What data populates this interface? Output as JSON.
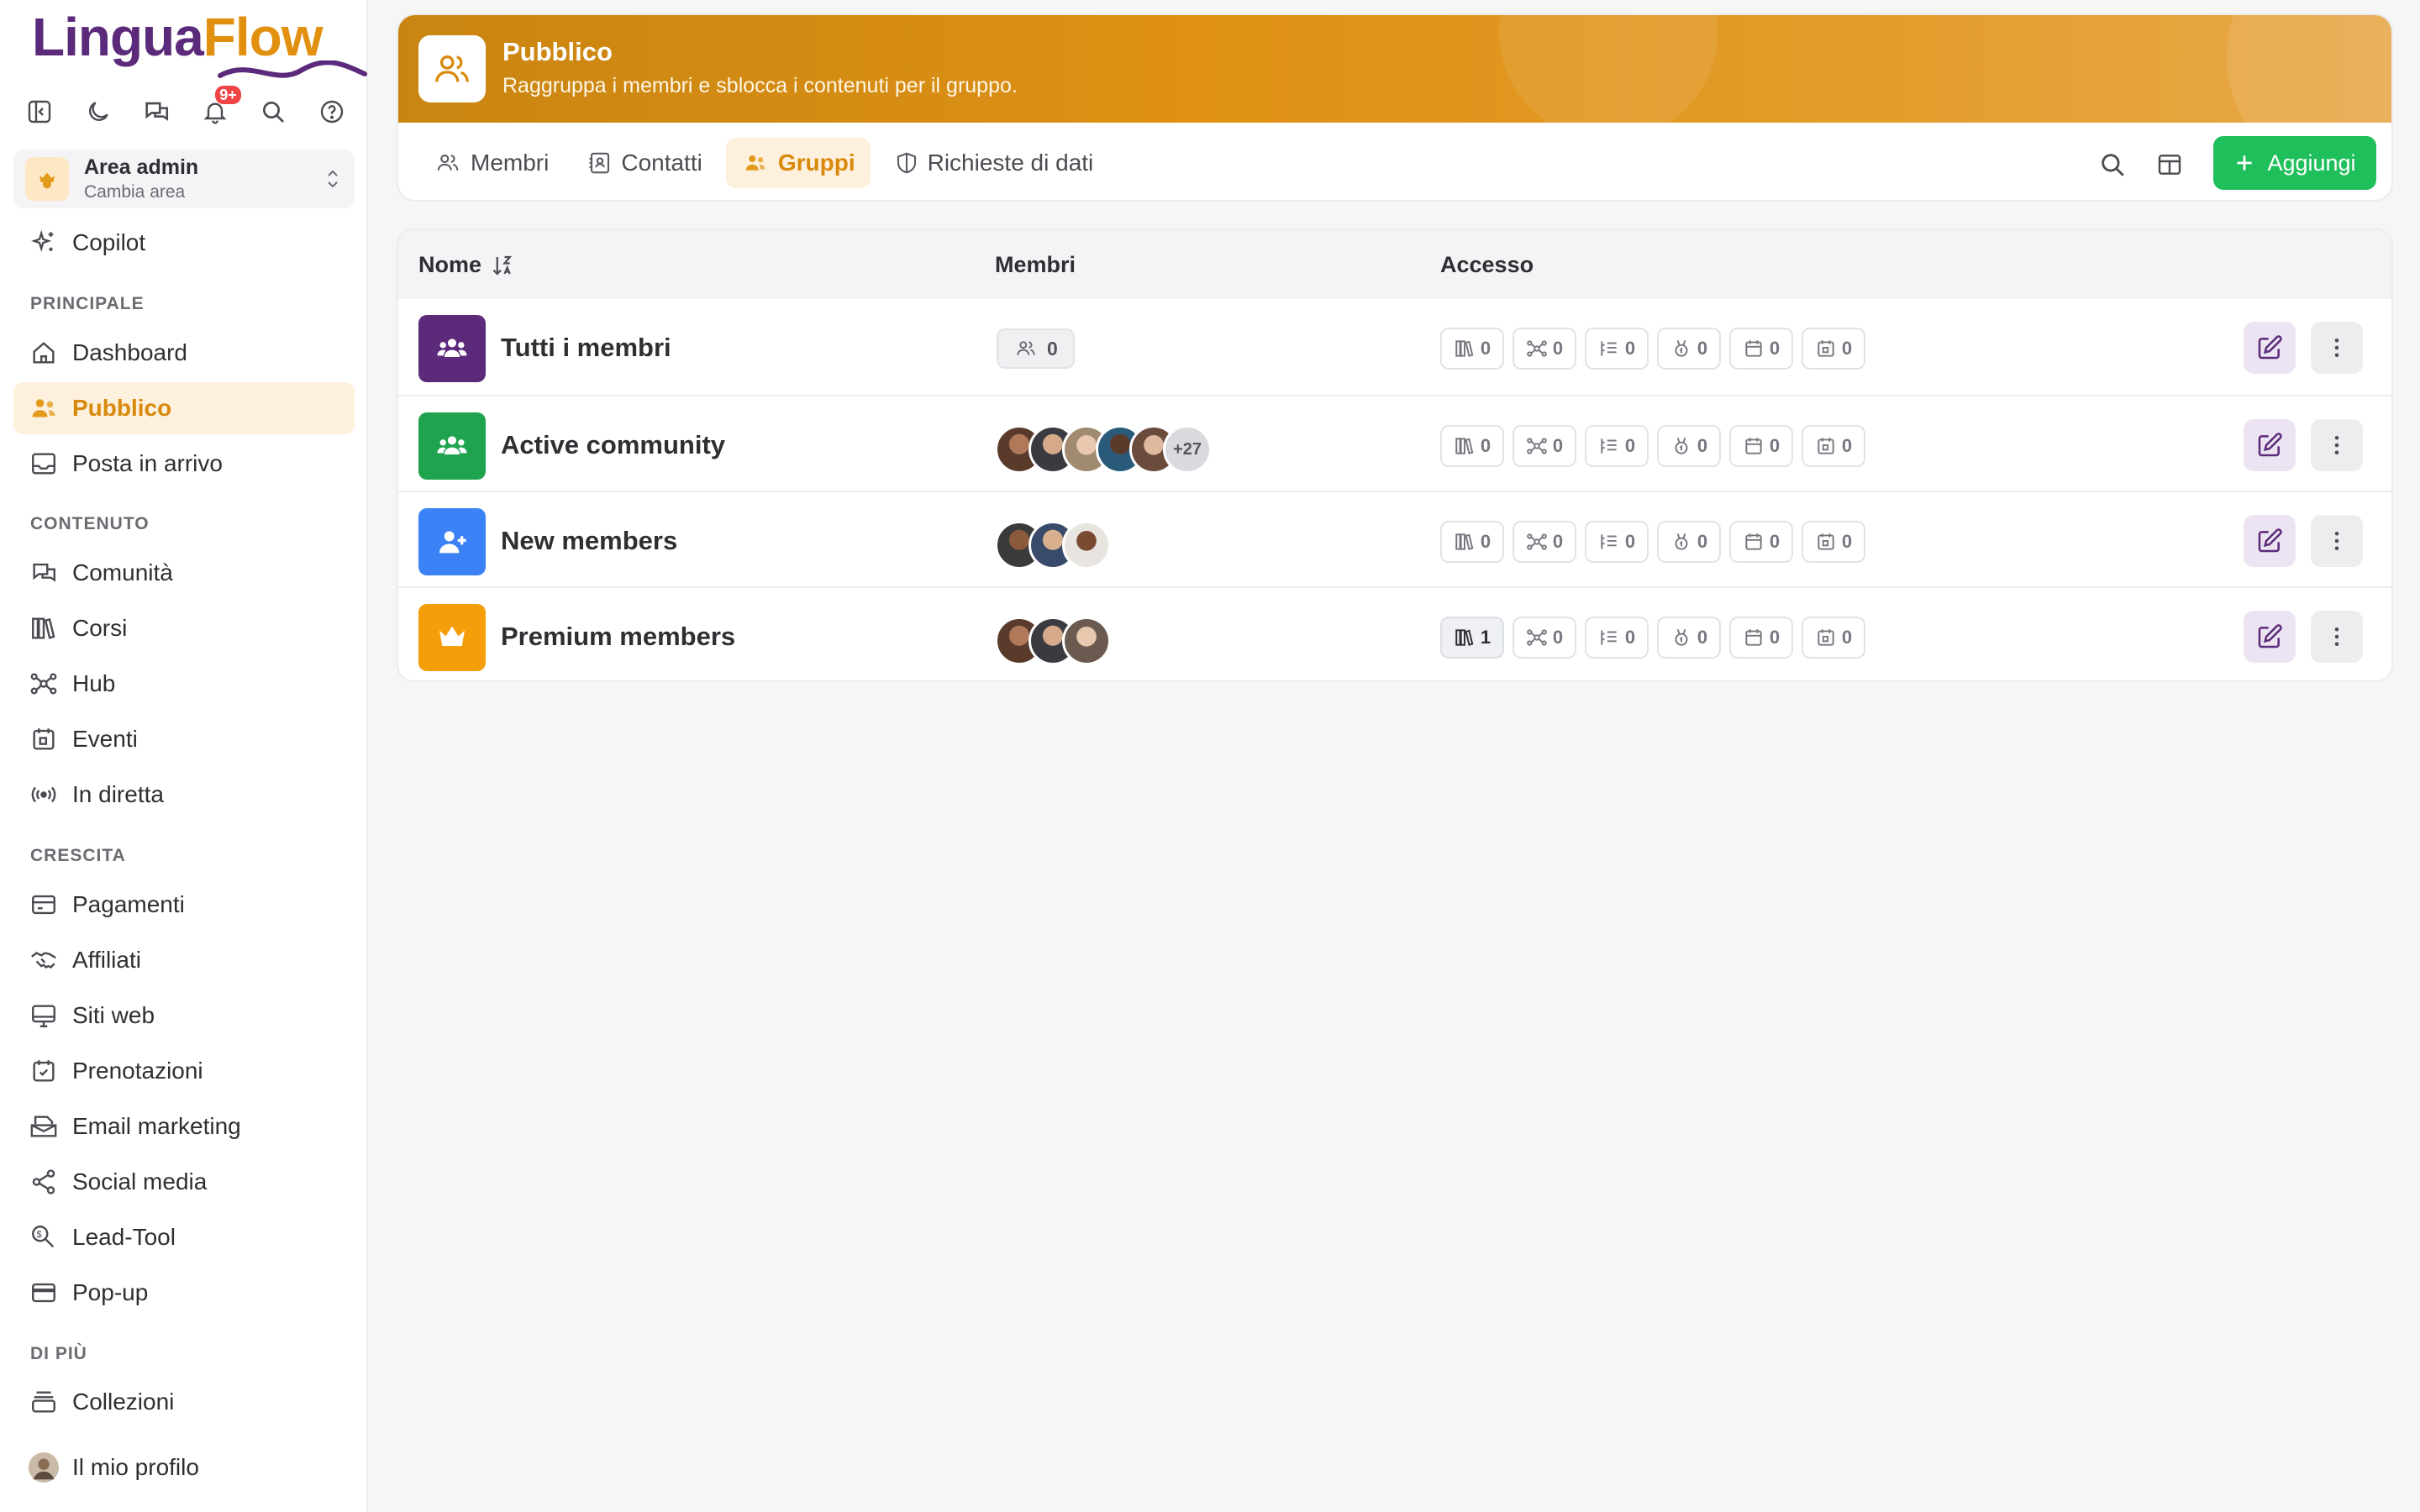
{
  "app": {
    "logo_part1": "Lingua",
    "logo_part2": "Flow",
    "notification_count": "9+",
    "brand_purple": "#5b2a7a",
    "brand_orange": "#e2900f"
  },
  "area": {
    "title": "Area admin",
    "subtitle": "Cambia area"
  },
  "sidebar": {
    "copilot": "Copilot",
    "sections": {
      "principale": "PRINCIPALE",
      "contenuto": "CONTENUTO",
      "crescita": "CRESCITA",
      "di_piu": "DI PIÙ"
    },
    "items": {
      "dashboard": "Dashboard",
      "pubblico": "Pubblico",
      "posta": "Posta in arrivo",
      "comunita": "Comunità",
      "corsi": "Corsi",
      "hub": "Hub",
      "eventi": "Eventi",
      "diretta": "In diretta",
      "pagamenti": "Pagamenti",
      "affiliati": "Affiliati",
      "siti": "Siti web",
      "prenotazioni": "Prenotazioni",
      "email": "Email marketing",
      "social": "Social media",
      "lead": "Lead-Tool",
      "popup": "Pop-up",
      "collezioni": "Collezioni",
      "profilo": "Il mio profilo"
    }
  },
  "header": {
    "title": "Pubblico",
    "subtitle": "Raggruppa i membri e sblocca i contenuti per il gruppo.",
    "tabs": {
      "membri": "Membri",
      "contatti": "Contatti",
      "gruppi": "Gruppi",
      "richieste": "Richieste di dati"
    },
    "add_label": "Aggiungi"
  },
  "table": {
    "columns": {
      "nome": "Nome",
      "membri": "Membri",
      "accesso": "Accesso"
    },
    "rows": [
      {
        "name": "Tutti i membri",
        "icon": "users-group-icon",
        "color": "#5b2a7a",
        "member_count": "0",
        "access": [
          "0",
          "0",
          "0",
          "0",
          "0",
          "0"
        ]
      },
      {
        "name": "Active community",
        "icon": "users-group-icon",
        "color": "#1fa34f",
        "more_members": "+27",
        "access": [
          "0",
          "0",
          "0",
          "0",
          "0",
          "0"
        ]
      },
      {
        "name": "New members",
        "icon": "user-plus-icon",
        "color": "#3b82f6",
        "access": [
          "0",
          "0",
          "0",
          "0",
          "0",
          "0"
        ]
      },
      {
        "name": "Premium members",
        "icon": "crown-icon",
        "color": "#f59e0b",
        "access": [
          "1",
          "0",
          "0",
          "0",
          "0",
          "0"
        ]
      }
    ],
    "access_icons": [
      "courses-icon",
      "hub-icon",
      "list-icon",
      "badge-icon",
      "calendar-icon",
      "event-icon"
    ]
  }
}
